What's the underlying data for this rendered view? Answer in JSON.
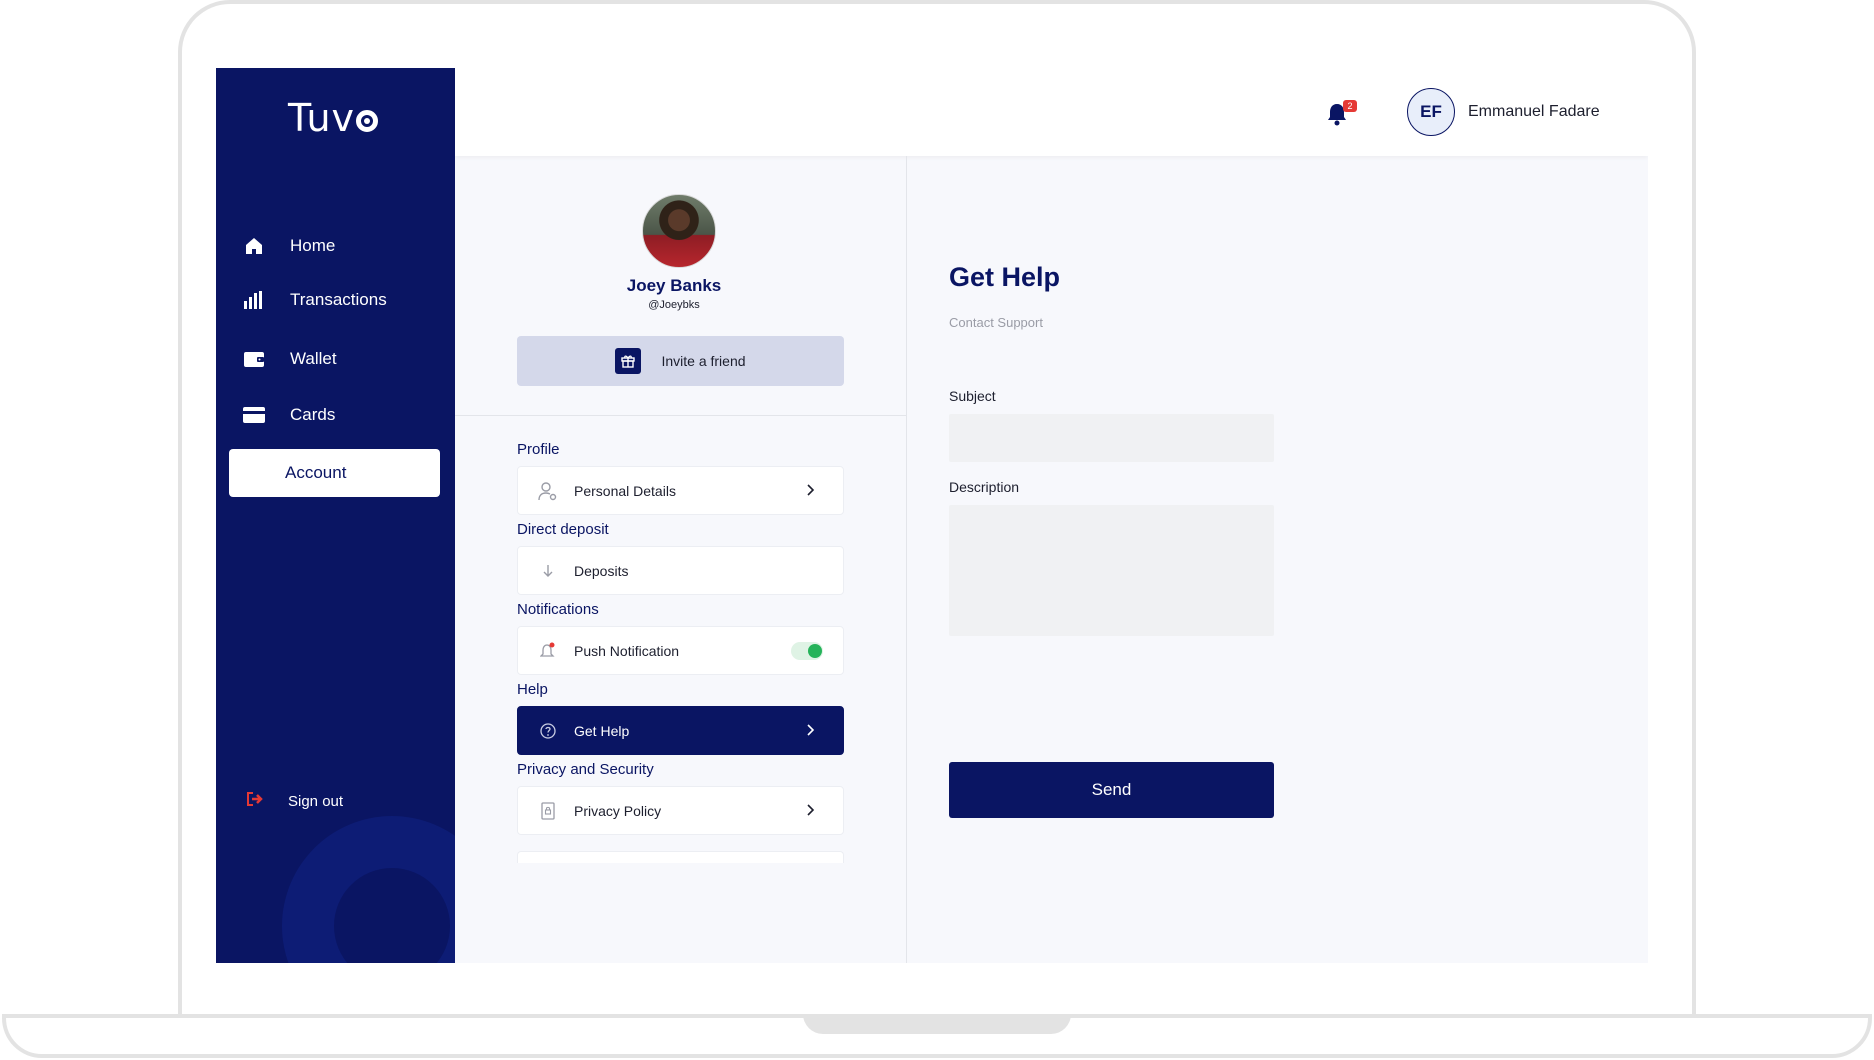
{
  "app": {
    "logo": "Tuv"
  },
  "sidebar": {
    "items": [
      {
        "label": "Home",
        "icon": "home-icon"
      },
      {
        "label": "Transactions",
        "icon": "bar-chart-icon"
      },
      {
        "label": "Wallet",
        "icon": "wallet-icon"
      },
      {
        "label": "Cards",
        "icon": "card-icon"
      },
      {
        "label": "Account",
        "active": true
      }
    ],
    "signout_label": "Sign out"
  },
  "header": {
    "notification_count": "2",
    "user_initials": "EF",
    "user_name": "Emmanuel Fadare"
  },
  "profile": {
    "name": "Joey Banks",
    "handle": "@Joeybks",
    "invite_label": "Invite a friend"
  },
  "settings": {
    "profile_title": "Profile",
    "personal_details": "Personal Details",
    "deposit_title": "Direct deposit",
    "deposits": "Deposits",
    "notifications_title": "Notifications",
    "push_notification": "Push Notification",
    "push_enabled": true,
    "help_title": "Help",
    "get_help": "Get Help",
    "privacy_title": "Privacy and Security",
    "privacy_policy": "Privacy Policy"
  },
  "help_form": {
    "title": "Get Help",
    "subtitle": "Contact Support",
    "subject_label": "Subject",
    "subject_value": "",
    "description_label": "Description",
    "description_value": "",
    "send_label": "Send"
  },
  "colors": {
    "primary": "#0a1563",
    "toggle_on": "#25b35a",
    "badge": "#e53935",
    "signout_icon": "#e53935"
  }
}
